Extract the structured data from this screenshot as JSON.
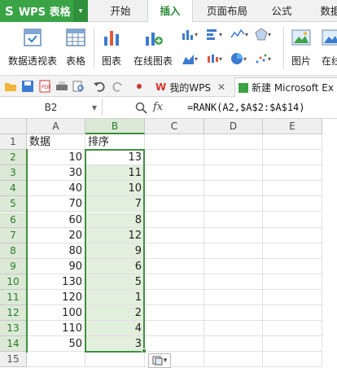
{
  "app": {
    "logo": "S",
    "title": "WPS 表格",
    "menu_arrow": "▾"
  },
  "menu": {
    "tabs": [
      {
        "label": "开始"
      },
      {
        "label": "插入"
      },
      {
        "label": "页面布局"
      },
      {
        "label": "公式"
      },
      {
        "label": "数据"
      }
    ],
    "active": "插入"
  },
  "ribbon": {
    "pivot": "数据透视表",
    "table": "表格",
    "chart": "图表",
    "online_chart": "在线图表",
    "picture": "图片",
    "online_picture": "在线"
  },
  "qat": {
    "tab1": "我的WPS",
    "tab2": "新建 Microsoft Ex"
  },
  "formula_bar": {
    "name_box": "B2",
    "fx": "fx",
    "formula": "=RANK(A2,$A$2:$A$14)"
  },
  "sheet": {
    "columns": [
      "A",
      "B",
      "C",
      "D",
      "E"
    ],
    "row_numbers": [
      "1",
      "2",
      "3",
      "4",
      "5",
      "6",
      "7",
      "8",
      "9",
      "10",
      "11",
      "12",
      "13",
      "14",
      "15"
    ],
    "headers": {
      "a": "数据",
      "b": "排序"
    },
    "rows": [
      {
        "a": "10",
        "b": "13"
      },
      {
        "a": "30",
        "b": "11"
      },
      {
        "a": "40",
        "b": "10"
      },
      {
        "a": "70",
        "b": "7"
      },
      {
        "a": "60",
        "b": "8"
      },
      {
        "a": "20",
        "b": "12"
      },
      {
        "a": "80",
        "b": "9"
      },
      {
        "a": "90",
        "b": "6"
      },
      {
        "a": "130",
        "b": "5"
      },
      {
        "a": "120",
        "b": "1"
      },
      {
        "a": "100",
        "b": "2"
      },
      {
        "a": "110",
        "b": "4"
      },
      {
        "a": "50",
        "b": "3"
      }
    ]
  },
  "colors": {
    "accent": "#3aa346",
    "selection": "#e3efdd",
    "selection_border": "#3f8f3f"
  },
  "icons": {
    "pivot": "pivot-table-icon",
    "table": "table-icon",
    "chart": "bar-chart-icon",
    "online_chart": "online-chart-icon",
    "picture": "picture-icon"
  }
}
